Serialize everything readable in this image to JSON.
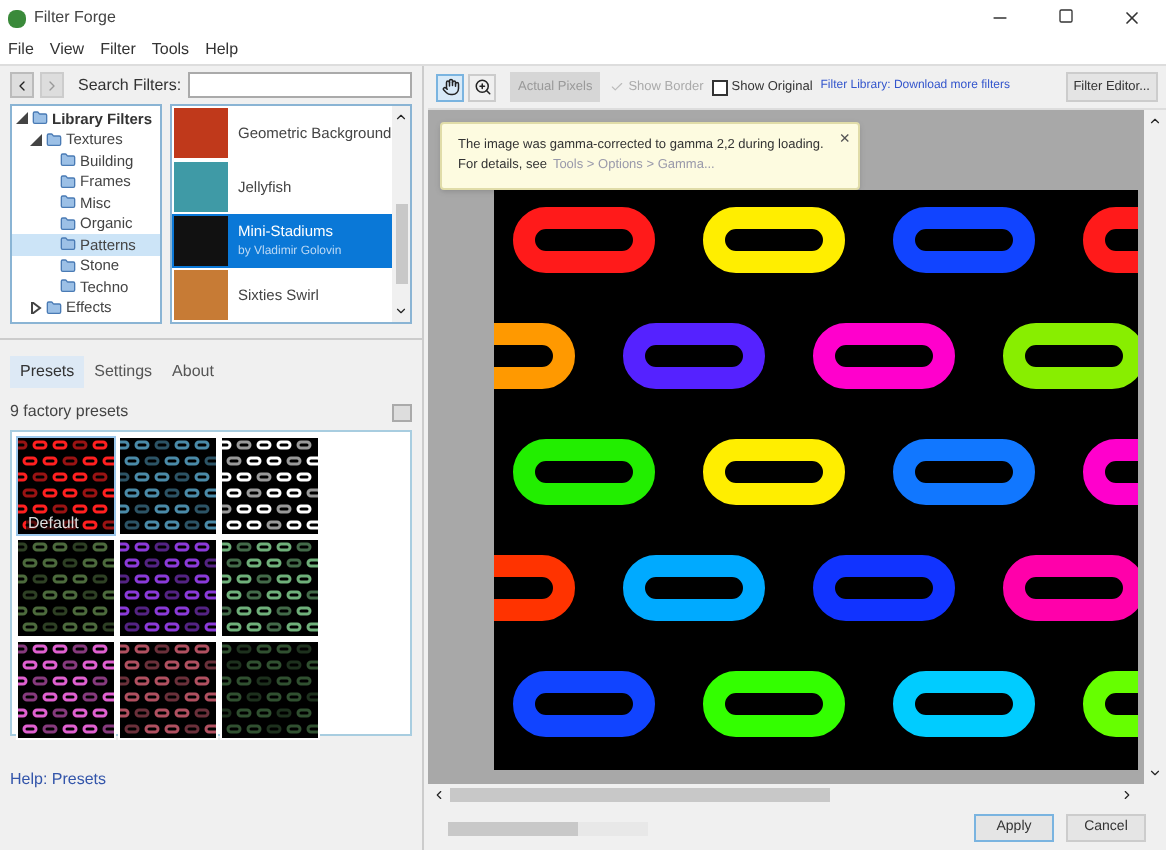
{
  "window": {
    "title": "Filter Forge"
  },
  "menu": [
    "File",
    "View",
    "Filter",
    "Tools",
    "Help"
  ],
  "search": {
    "label": "Search Filters:"
  },
  "tree": [
    {
      "label": "Library Filters",
      "expanded": true,
      "selected": false,
      "children": [
        {
          "label": "Textures",
          "expanded": true,
          "selected": false,
          "children": [
            {
              "label": "Building",
              "selected": false
            },
            {
              "label": "Frames",
              "selected": false
            },
            {
              "label": "Misc",
              "selected": false
            },
            {
              "label": "Organic",
              "selected": false
            },
            {
              "label": "Patterns",
              "selected": true
            },
            {
              "label": "Stone",
              "selected": false
            },
            {
              "label": "Techno",
              "selected": false
            }
          ]
        },
        {
          "label": "Effects",
          "expanded": false,
          "selected": false
        }
      ]
    }
  ],
  "filters": [
    {
      "name": "Geometric Background",
      "selected": false,
      "color": "#c0391b"
    },
    {
      "name": "Jellyfish",
      "selected": false,
      "color": "#3f9aa6"
    },
    {
      "name": "Mini-Stadiums",
      "author": "by Vladimir Golovin",
      "selected": true,
      "color": "#111111"
    },
    {
      "name": "Sixties Swirl",
      "selected": false,
      "color": "#c77b35"
    }
  ],
  "tabs": [
    {
      "label": "Presets",
      "selected": true
    },
    {
      "label": "Settings",
      "selected": false
    },
    {
      "label": "About",
      "selected": false
    }
  ],
  "presets_count": "9 factory presets",
  "presets": [
    {
      "label": "Default",
      "selected": true,
      "color": "#ff2020"
    },
    {
      "selected": false,
      "color": "#4a8aa8"
    },
    {
      "selected": false,
      "color": "#ffffff"
    },
    {
      "selected": false,
      "color": "#4c6a3c"
    },
    {
      "selected": false,
      "color": "#8a3ad8"
    },
    {
      "selected": false,
      "color": "#6fb07a"
    },
    {
      "selected": false,
      "color": "#e060d0"
    },
    {
      "selected": false,
      "color": "#b05060"
    },
    {
      "selected": false,
      "color": "#305030"
    }
  ],
  "help_link": "Help: Presets",
  "toolbar": {
    "actual_pixels": "Actual Pixels",
    "show_border": {
      "label": "Show Border",
      "checked": true,
      "disabled": true
    },
    "show_original": {
      "label": "Show Original",
      "checked": false
    },
    "library_link": "Filter Library: Download more filters",
    "editor_button": "Filter Editor..."
  },
  "notice": {
    "line1": "The image was gamma-corrected to gamma 2,2 during loading.",
    "line2_prefix": "For details, see",
    "line2_link": "Tools > Options > Gamma...",
    "close": "×"
  },
  "progress": {
    "level": 0.65
  },
  "buttons": [
    "Apply",
    "Cancel"
  ]
}
